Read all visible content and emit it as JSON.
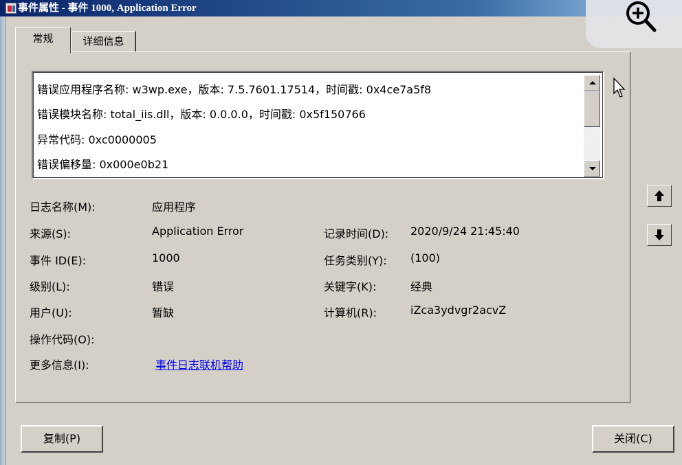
{
  "window": {
    "title": "事件属性 - 事件 1000, Application Error"
  },
  "tabs": [
    {
      "label": "常规",
      "active": true
    },
    {
      "label": "详细信息",
      "active": false
    }
  ],
  "description_lines": [
    "错误应用程序名称: w3wp.exe，版本: 7.5.7601.17514，时间戳: 0x4ce7a5f8",
    "错误模块名称: total_iis.dll，版本: 0.0.0.0，时间戳: 0x5f150766",
    "异常代码: 0xc0000005",
    "错误偏移量: 0x000e0b21"
  ],
  "fields": {
    "log_name": {
      "label": "日志名称(M):",
      "value": "应用程序"
    },
    "source": {
      "label": "来源(S):",
      "value": "Application Error"
    },
    "logged": {
      "label": "记录时间(D):",
      "value": "2020/9/24 21:45:40"
    },
    "event_id": {
      "label": "事件 ID(E):",
      "value": "1000"
    },
    "task_category": {
      "label": "任务类别(Y):",
      "value": "(100)"
    },
    "level": {
      "label": "级别(L):",
      "value": "错误"
    },
    "keywords": {
      "label": "关键字(K):",
      "value": "经典"
    },
    "user": {
      "label": "用户(U):",
      "value": "暂缺"
    },
    "computer": {
      "label": "计算机(R):",
      "value": "iZca3ydvgr2acvZ"
    },
    "opcode": {
      "label": "操作代码(O):",
      "value": ""
    },
    "more_info": {
      "label": "更多信息(I):",
      "link": "事件日志联机帮助"
    }
  },
  "buttons": {
    "copy": "复制(P)",
    "close": "关闭(C)"
  },
  "icons": {
    "zoom": "zoom-in-icon",
    "prev": "arrow-up-icon",
    "next": "arrow-down-icon",
    "cursor": "mouse-pointer-icon"
  },
  "colors": {
    "title_bar": "#0a246a",
    "dialog_bg": "#d4d0c8",
    "link": "#0000ee"
  }
}
